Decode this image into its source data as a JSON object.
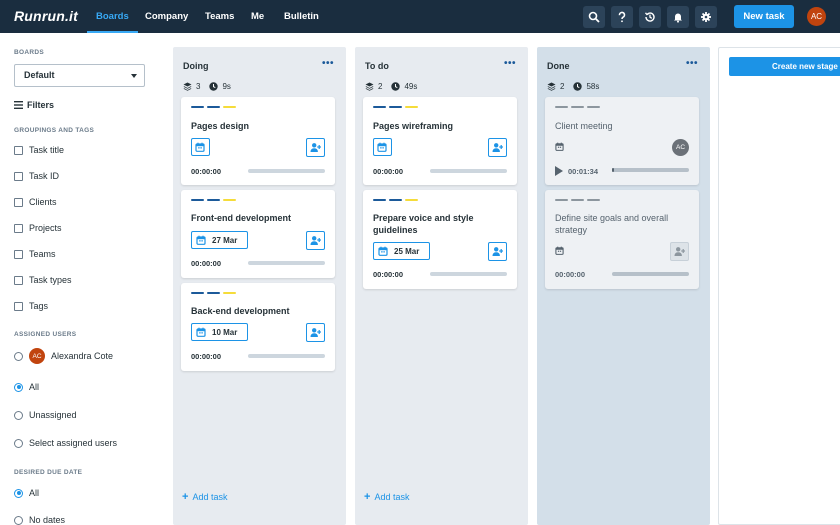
{
  "app": {
    "logo": "Runrun.it"
  },
  "topnav": {
    "items": [
      {
        "label": "Boards",
        "active": true
      },
      {
        "label": "Company"
      },
      {
        "label": "Teams"
      },
      {
        "label": "Me"
      },
      {
        "label": "Bulletin"
      }
    ],
    "icons": [
      "search-icon",
      "help-icon",
      "history-icon",
      "bell-icon",
      "gear-icon"
    ],
    "new_task_label": "New task",
    "user_initials": "AC",
    "accent_color": "#38a9f5",
    "bar_color": "#1a2d3f"
  },
  "sidebar": {
    "boards_title": "BOARDS",
    "board_select": "Default",
    "filters_label": "Filters",
    "groupings_title": "GROUPINGS AND TAGS",
    "groupings": [
      "Task title",
      "Task ID",
      "Clients",
      "Projects",
      "Teams",
      "Task types",
      "Tags"
    ],
    "assigned_title": "ASSIGNED USERS",
    "assigned_user": {
      "initials": "AC",
      "name": "Alexandra Cote"
    },
    "assigned_options": [
      {
        "label": "All",
        "selected": true
      },
      {
        "label": "Unassigned",
        "selected": false
      },
      {
        "label": "Select assigned users",
        "selected": false
      }
    ],
    "due_title": "DESIRED DUE DATE",
    "due_options": [
      {
        "label": "All",
        "selected": true
      },
      {
        "label": "No dates",
        "selected": false
      }
    ]
  },
  "columns": [
    {
      "title": "Doing",
      "count": "3",
      "time": "9s",
      "add_task": "Add task",
      "cards": [
        {
          "title": "Pages design",
          "date": "",
          "time": "00:00:00"
        },
        {
          "title": "Front-end development",
          "date": "27 Mar",
          "time": "00:00:00"
        },
        {
          "title": "Back-end development",
          "date": "10 Mar",
          "time": "00:00:00"
        }
      ]
    },
    {
      "title": "To do",
      "count": "2",
      "time": "49s",
      "add_task": "Add task",
      "cards": [
        {
          "title": "Pages wireframing",
          "date": "",
          "time": "00:00:00"
        },
        {
          "title": "Prepare voice and style guidelines",
          "date": "25 Mar",
          "time": "00:00:00"
        }
      ]
    },
    {
      "title": "Done",
      "count": "2",
      "time": "58s",
      "cards": [
        {
          "title": "Client meeting",
          "avatar": "AC",
          "time": "00:01:34",
          "progress": 0.02
        },
        {
          "title": "Define site goals and overall strategy",
          "time": "00:00:00"
        }
      ]
    }
  ],
  "create_stage_label": "Create new stage",
  "colors": {
    "primary": "#1c93e6",
    "bar_blue": "#1c5a9a",
    "bar_yellow": "#f5dc3a",
    "bar_grey": "#8c969e"
  }
}
